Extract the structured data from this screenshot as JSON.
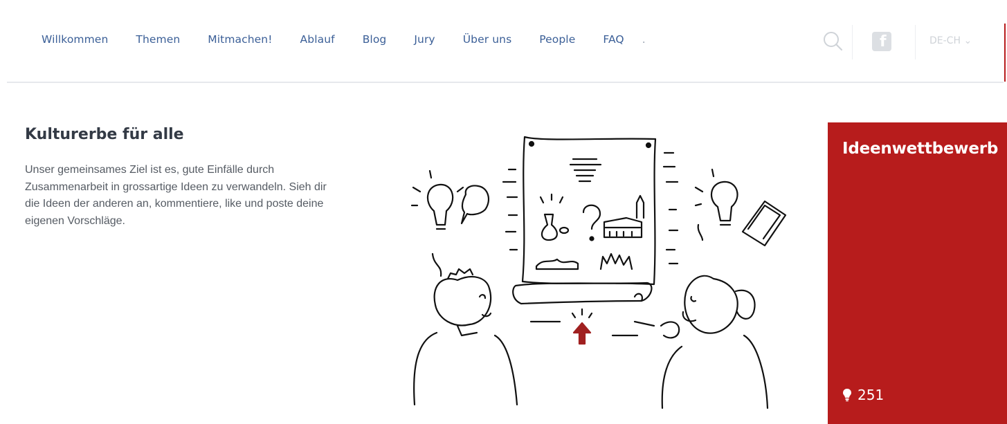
{
  "nav": {
    "items": [
      {
        "label": "Willkommen"
      },
      {
        "label": "Themen"
      },
      {
        "label": "Mitmachen!"
      },
      {
        "label": "Ablauf"
      },
      {
        "label": "Blog"
      },
      {
        "label": "Jury"
      },
      {
        "label": "Über uns"
      },
      {
        "label": "People"
      },
      {
        "label": "FAQ"
      },
      {
        "label": "."
      }
    ],
    "language": "DE-CH",
    "icons": [
      "search-icon",
      "facebook-icon",
      "chevron-down-icon"
    ]
  },
  "intro": {
    "title": "Kulturerbe für alle",
    "text": "Unser gemeinsames Ziel ist es, gute Einfälle durch Zusammenarbeit in grossartige Ideen zu verwandeln. Sieh dir die Ideen der anderen an, kommentiere, like und poste deine eigenen Vorschläge."
  },
  "card": {
    "title": "Ideenwettbewerb",
    "count": "251",
    "icon": "lightbulb-icon"
  },
  "colors": {
    "nav_text": "#3b5f97",
    "accent": "#b71c1c",
    "heading": "#333a45",
    "body_text": "#555b63"
  }
}
